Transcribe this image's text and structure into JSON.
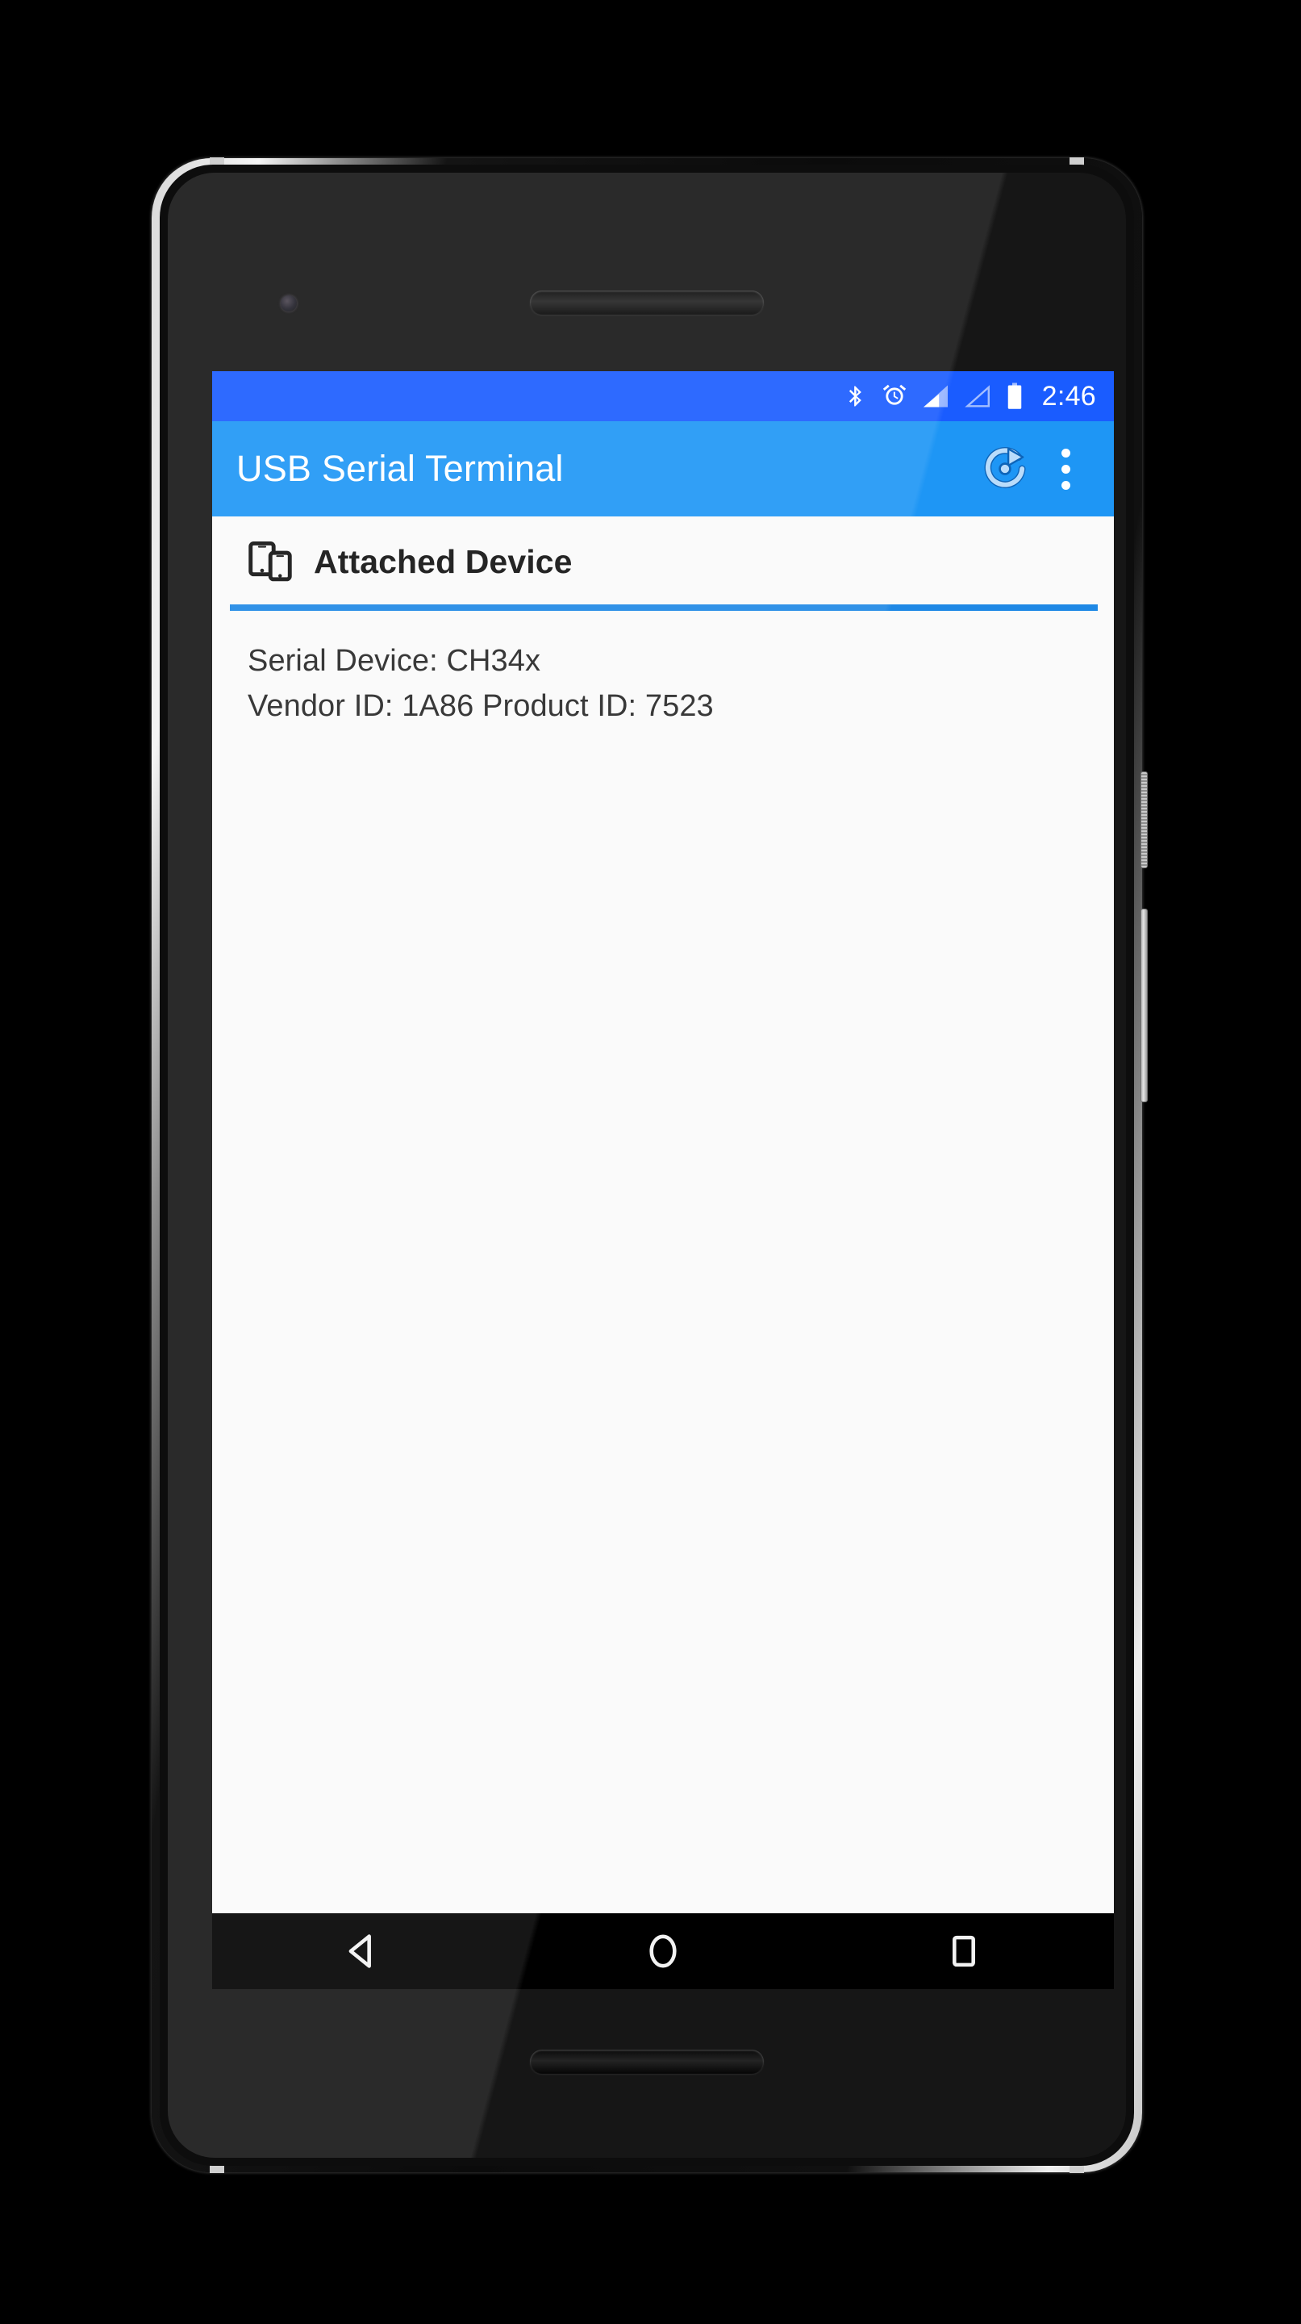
{
  "device_frame": {
    "label": "android-phone-mockup",
    "camera": "front-camera",
    "speaker_top": "earpiece-speaker",
    "speaker_bottom": "bottom-speaker",
    "power_button": "power-button",
    "volume_button": "volume-rocker"
  },
  "status_bar": {
    "background": "#1a5cff",
    "time": "2:46",
    "icons": [
      {
        "name": "bluetooth-icon",
        "label": "Bluetooth"
      },
      {
        "name": "alarm-icon",
        "label": "Alarm set"
      },
      {
        "name": "signal-sim1-icon",
        "label": "Cellular signal SIM 1"
      },
      {
        "name": "signal-sim2-icon",
        "label": "Cellular signal SIM 2 (no signal)"
      },
      {
        "name": "battery-icon",
        "label": "Battery full"
      }
    ]
  },
  "app_bar": {
    "background": "#1e96f5",
    "title": "USB Serial Terminal",
    "refresh_label": "Refresh",
    "overflow_label": "More options"
  },
  "content": {
    "background": "#fafafa",
    "accent": "#1e88e5",
    "section": {
      "icon": "devices-icon",
      "title": "Attached Device"
    },
    "device_info": {
      "serial_device": "Serial Device: CH34x",
      "ids": "Vendor ID: 1A86  Product ID: 7523"
    }
  },
  "nav_bar": {
    "background": "#000000",
    "buttons": [
      {
        "name": "nav-back-button",
        "label": "Back"
      },
      {
        "name": "nav-home-button",
        "label": "Home"
      },
      {
        "name": "nav-recents-button",
        "label": "Recent apps"
      }
    ]
  }
}
